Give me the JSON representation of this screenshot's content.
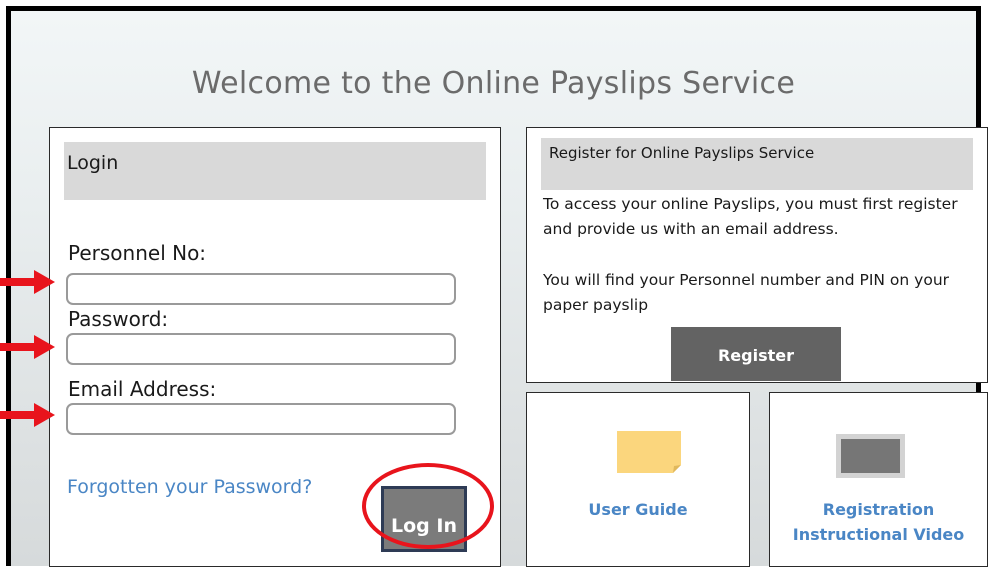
{
  "page": {
    "title": "Welcome to the Online Payslips Service"
  },
  "login": {
    "heading": "Login",
    "personnel_label": "Personnel No:",
    "personnel_value": "",
    "password_label": "Password:",
    "password_value": "",
    "email_label": "Email Address:",
    "email_value": "",
    "forgot_link": "Forgotten your Password?",
    "login_button": "Log In"
  },
  "register": {
    "heading": "Register for Online Payslips Service",
    "text_1": "To access your online Payslips, you must first register and provide us with an email address.",
    "text_2": "You will find your Personnel number and PIN on your paper payslip",
    "button": "Register"
  },
  "tiles": {
    "user_guide": "User Guide",
    "video_line_1": "Registration",
    "video_line_2": "Instructional Video"
  },
  "colors": {
    "link": "#4a86c5",
    "annotation": "#e8141c",
    "button_gray": "#636363"
  },
  "icons": {
    "user_guide": "sticky-note-icon",
    "video": "video-screen-icon"
  }
}
